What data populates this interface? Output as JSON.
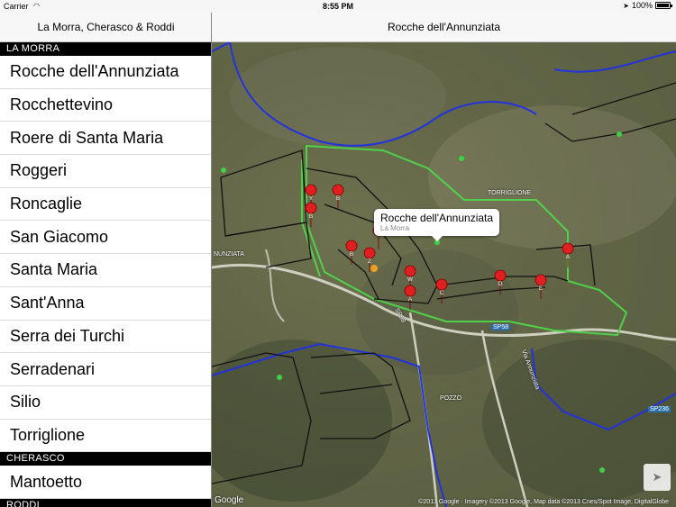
{
  "status_bar": {
    "carrier": "Carrier",
    "time": "8:55 PM",
    "battery": "100%"
  },
  "master": {
    "title": "La Morra, Cherasco & Roddi",
    "sections": [
      {
        "header": "LA MORRA",
        "items": [
          "Rocche dell'Annunziata",
          "Rocchettevino",
          "Roere di Santa Maria",
          "Roggeri",
          "Roncaglie",
          "San Giacomo",
          "Santa Maria",
          "Sant'Anna",
          "Serra dei Turchi",
          "Serradenari",
          "Silio",
          "Torriglione"
        ]
      },
      {
        "header": "CHERASCO",
        "items": [
          "Mantoetto"
        ]
      },
      {
        "header": "RODDI",
        "items": []
      }
    ]
  },
  "detail": {
    "title": "Rocche dell'Annunziata",
    "callout": {
      "title": "Rocche dell'Annunziata",
      "subtitle": "La Morra"
    },
    "labels": {
      "torriglione": "TORRIGLIONE",
      "annunziata": "NUNZIATA",
      "pozzo": "POZZO",
      "via": "Via Annunziata"
    },
    "roads": [
      "SP58",
      "SP236",
      "SP58"
    ],
    "markers": [
      "A",
      "B",
      "C",
      "D",
      "E",
      "W",
      "Y",
      "Z",
      "A",
      "B",
      "Y",
      "B"
    ],
    "google": "Google",
    "attribution": "©2013 Google · Imagery ©2013 Google, Map data ©2013 Cnes/Spot Image, DigitalGlobe",
    "colors": {
      "boundary_green": "#4fd24a",
      "boundary_blue": "#2233dd",
      "marker_red": "#e02020"
    }
  }
}
